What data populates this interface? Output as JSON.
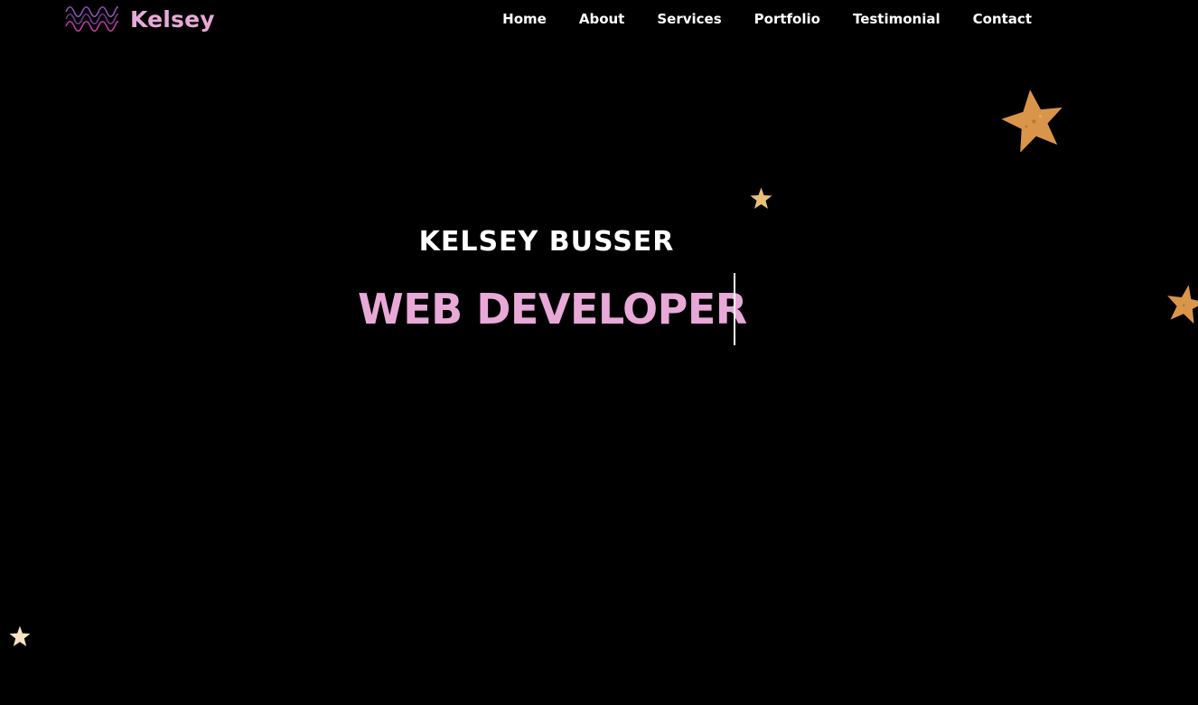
{
  "nav": {
    "brand": {
      "name": "Kelsey",
      "logo_icon": "wave-lines-icon"
    },
    "links": [
      {
        "label": "Home"
      },
      {
        "label": "About"
      },
      {
        "label": "Services"
      },
      {
        "label": "Portfolio"
      },
      {
        "label": "Testimonial"
      },
      {
        "label": "Contact"
      }
    ]
  },
  "hero": {
    "name": "KELSEY BUSSER",
    "role": "WEB DEVELOPER"
  },
  "decorations": {
    "star_icon": "star-icon"
  },
  "colors": {
    "background": "#000000",
    "accent_pink": "#e8a9d8",
    "logo_purple": "#6a3d8c",
    "logo_magenta": "#c0399e",
    "star_gold": "#d9954a",
    "star_pale": "#f2d9a0",
    "text": "#ffffff"
  }
}
